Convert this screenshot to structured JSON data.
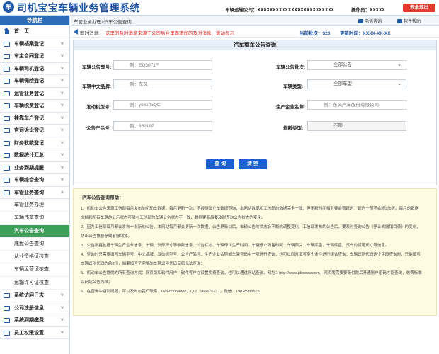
{
  "header": {
    "logo_glyph": "车",
    "title": "司机宝宝车辆业务管理系统",
    "company": "车辆运输公司：XXXXXXXXXXXXXXXXXXXXXXXXX",
    "operator": "操作员：XXXXX",
    "logout": "安全退出"
  },
  "sidebar": {
    "heading": "导航栏",
    "items_top": [
      {
        "label": "首　页",
        "icon": "home-icon",
        "chev": ""
      },
      {
        "label": "车辆档案登记",
        "icon": "folder-icon",
        "chev": "˅"
      },
      {
        "label": "车主合同登记",
        "icon": "contract-icon",
        "chev": "˅"
      },
      {
        "label": "车辆司机登记",
        "icon": "driver-icon",
        "chev": "˅"
      },
      {
        "label": "车辆保险登记",
        "icon": "insurance-icon",
        "chev": "˅"
      },
      {
        "label": "运管业务登记",
        "icon": "transport-icon",
        "chev": "˅"
      },
      {
        "label": "车辆税费登记",
        "icon": "tax-icon",
        "chev": "˅"
      },
      {
        "label": "挂靠车户登记",
        "icon": "affiliate-icon",
        "chev": "˅"
      },
      {
        "label": "官司诉讼登记",
        "icon": "lawsuit-icon",
        "chev": "˅"
      },
      {
        "label": "财务收款登记",
        "icon": "finance-icon",
        "chev": "˅"
      },
      {
        "label": "数据统计汇总",
        "icon": "stats-icon",
        "chev": "˅"
      },
      {
        "label": "业务到期提醒",
        "icon": "reminder-icon",
        "chev": "˅"
      },
      {
        "label": "车辆综合查询",
        "icon": "query-icon",
        "chev": "˅"
      },
      {
        "label": "车管业务查询",
        "icon": "vehicle-admin-icon",
        "chev": "˄"
      }
    ],
    "sub_items": [
      {
        "label": "车管业务办理"
      },
      {
        "label": "车辆违章查询"
      },
      {
        "label": "汽车公告查询"
      },
      {
        "label": "底盘公告查询"
      },
      {
        "label": "从业资格证核查"
      },
      {
        "label": "车辆运营证核查"
      },
      {
        "label": "运输许可证核查"
      }
    ],
    "items_bottom": [
      {
        "label": "系统访问日志",
        "icon": "log-icon",
        "chev": "˅"
      },
      {
        "label": "公司注册信息",
        "icon": "company-icon",
        "chev": "˅"
      },
      {
        "label": "系统到期缴费",
        "icon": "payment-icon",
        "chev": "˅"
      },
      {
        "label": "员工权限设置",
        "icon": "permission-icon",
        "chev": "˅"
      }
    ]
  },
  "topbar": {
    "breadcrumb": "车管业务办理>汽车公告查询",
    "phone": "电话咨询",
    "help": "软件帮助"
  },
  "notice": {
    "label": "即时消息:",
    "text": "这里的及时消息来源于公司后台里面添加的及时消息、滚动显示",
    "batch": "当前批次：323",
    "updated": "更新时间：XXXX-XX-XX"
  },
  "search": {
    "title": "汽车整车公告查询",
    "model_label": "车辆公告型号:",
    "model_placeholder": "例：EQ3071F",
    "batch_label": "车辆公告批次:",
    "batch_value": "全部公告",
    "cn_name_label": "车辆中文品牌:",
    "cn_name_placeholder": "例：东风",
    "type_label": "车辆类型:",
    "type_value": "全部车型",
    "engine_label": "发动机型号:",
    "engine_placeholder": "例：yc6105QC",
    "maker_label": "生产企业名称:",
    "maker_placeholder": "例：东风汽车股份有限公司",
    "product_label": "公告产品号:",
    "product_placeholder": "例：652187",
    "fuel_label": "燃料类型:",
    "fuel_value": "不限",
    "query_button": "查 询",
    "clear_button": "清 空"
  },
  "info": {
    "title": "汽车公告查询帮助：",
    "paragraphs": [
      "1、机动车公告来源工信部每月发布的机动车数据，每月更新一次，不接待法立车数据查询；本网站数据和工信部的数据完全一致；但更新时间相对要会有延迟，延迟一般不会超过5天。每月的数据",
      "文档和所有车辆的公示状态可能与工信部的车辆公告状态不一致，数据更新后要及时查询公告状态的变化。",
      "2、因为工信部每月都会发布一批新的公告，本网站每月都会更新一次数据，公告更新以后，车辆公告的状态会不断的调整变化，工信部发布的公告后，要及时查询公告《停止或撤销目录》的变化，",
      "防止公告被暂停或者撤销掉。",
      "3、公告数据包括车辆生产企业信息、车辆、外形尺寸等参数信息、公告状态、车辆停止生产时间、车辆停止销售时间、车辆照片、车辆底盘、车辆底盘、货车的货箱尺寸等信息。",
      "4、查询时只需要填写车辆型号、中文品牌、发动机型号、公告产品号、生产企业名称或车架号码中一项进行查询，也可以同时填写多个条件进行组合查询；车辆识别代码这个字段查询时，只能填写",
      "车辆识别代码的前8位，如果填写了完整的车辆识别代码反而无法查询；",
      "5、机动车公告提供的所有查询方式：网页版和软件用户；软件客户在设置免费查询，也可以通过网站查询。网址：http://www.jdcwww.com，网页版需要要新付款后开通账户密码才能查询，收费标准",
      "以网站公告为准；",
      "6、在查询中遇到问题，可以及时与我们联系：028-85054888，QQ：965676271，微信：19828933515"
    ]
  },
  "colors": {
    "brand": "#1b4f9c",
    "nav_head": "#2f6cb8",
    "active_sub": "#3aa05a",
    "logout": "#e23a2e",
    "notice_text": "#e02020",
    "button": "#1c5fd0",
    "info_bg": "#fdfbe1"
  }
}
